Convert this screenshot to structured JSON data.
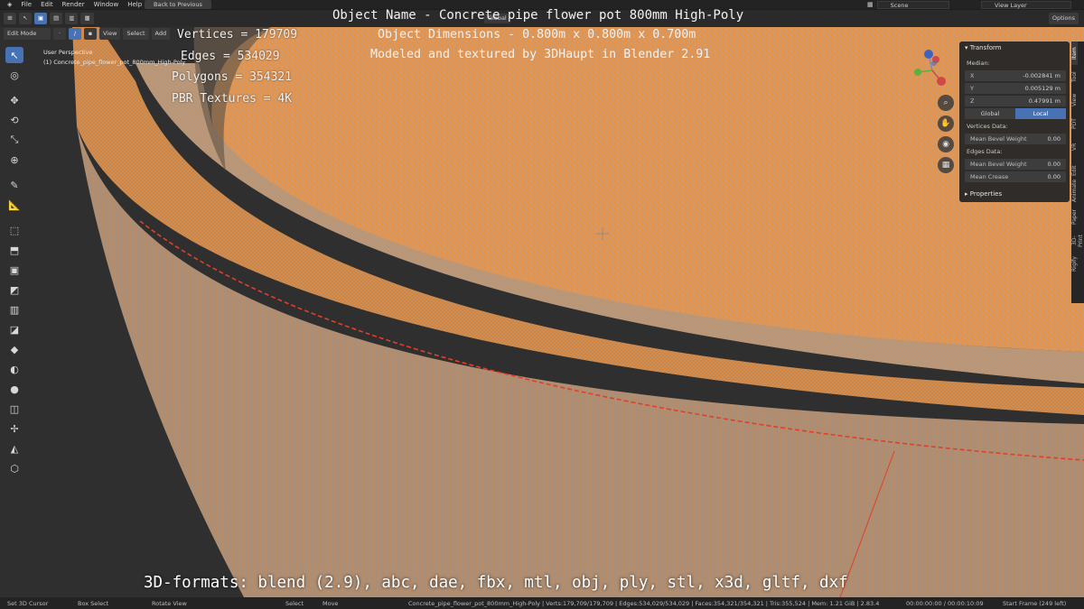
{
  "menu": [
    "File",
    "Edit",
    "Render",
    "Window",
    "Help"
  ],
  "back_button": "Back to Previous",
  "scene": "Scene",
  "view_layer": "View Layer",
  "header": {
    "mode": "Edit Mode",
    "view": "View",
    "select": "Select",
    "add": "Add",
    "transform_orientation": "Global",
    "options": "Options"
  },
  "viewport": {
    "perspective": "User Perspective",
    "object": "(1) Concrete_pipe_flower_pot_800mm_High-Poly"
  },
  "overlay": {
    "title": "Object Name - Concrete pipe flower pot 800mm High-Poly",
    "dimensions": "Object Dimensions -  0.800m x 0.800m x 0.700m",
    "credit": "Modeled and textured by 3DHaupt in Blender 2.91",
    "vertices": "Vertices = 179709",
    "edges": "Edges = 534029",
    "polygons": "Polygons = 354321",
    "textures": "PBR Textures = 4K",
    "formats": "3D-formats: blend (2.9), abc, dae, fbx, mtl, obj, ply, stl, x3d, gltf, dxf"
  },
  "npanel": {
    "transform_header": "Transform",
    "median_label": "Median:",
    "x_label": "X",
    "x_value": "-0.002841 m",
    "y_label": "Y",
    "y_value": "0.005129 m",
    "z_label": "Z",
    "z_value": "0.47991 m",
    "global": "Global",
    "local": "Local",
    "vertices_data": "Vertices Data:",
    "mean_bevel_weight_label": "Mean Bevel Weight",
    "mean_bevel_weight_v": "0.00",
    "edges_data": "Edges Data:",
    "mean_bevel_weight_e_label": "Mean Bevel Weight",
    "mean_bevel_weight_e": "0.00",
    "mean_crease_label": "Mean Crease",
    "mean_crease": "0.00",
    "properties_header": "Properties"
  },
  "side_tabs": [
    "Item",
    "Tool",
    "View",
    "PDT",
    "VR",
    "Edit",
    "Animate",
    "Paper",
    "3D-Print",
    "Rigify"
  ],
  "status": {
    "cursor": "Set 3D Cursor",
    "box_select": "Box Select",
    "rotate_view": "Rotate View",
    "select": "Select",
    "move": "Move",
    "info": "Concrete_pipe_flower_pot_800mm_High-Poly | Verts:179,709/179,709 | Edges:534,029/534,029 | Faces:354,321/354,321 | Tris:355,524 | Mem: 1.21 GiB | 2.83.4",
    "time": "00:00:00:00 / 00:00:10:09",
    "start_frame": "Start Frame (249 left)"
  },
  "colors": {
    "wire": "#ff8a1e",
    "selected_edge": "#e0402a",
    "accent": "#4772b3"
  }
}
